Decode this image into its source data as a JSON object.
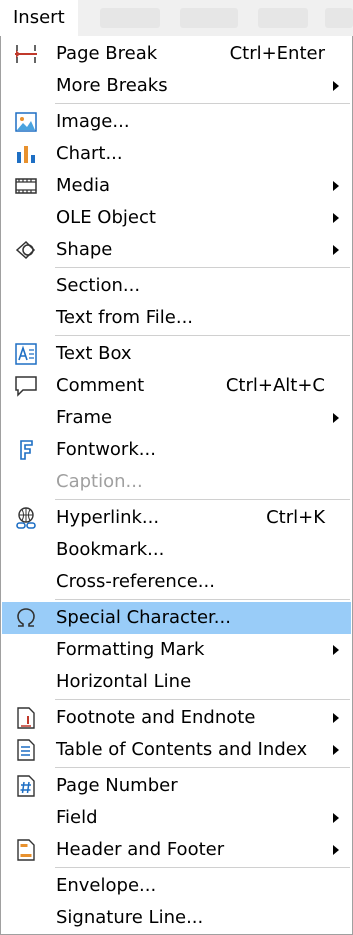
{
  "menubar": {
    "active_menu": "Insert"
  },
  "menu": {
    "items": [
      {
        "label": "Page Break",
        "shortcut": "Ctrl+Enter"
      },
      {
        "label": "More Breaks"
      },
      {
        "label": "Image..."
      },
      {
        "label": "Chart..."
      },
      {
        "label": "Media"
      },
      {
        "label": "OLE Object"
      },
      {
        "label": "Shape"
      },
      {
        "label": "Section..."
      },
      {
        "label": "Text from File..."
      },
      {
        "label": "Text Box"
      },
      {
        "label": "Comment",
        "shortcut": "Ctrl+Alt+C"
      },
      {
        "label": "Frame"
      },
      {
        "label": "Fontwork..."
      },
      {
        "label": "Caption...",
        "state": "disabled"
      },
      {
        "label": "Hyperlink...",
        "shortcut": "Ctrl+K"
      },
      {
        "label": "Bookmark..."
      },
      {
        "label": "Cross-reference..."
      },
      {
        "label": "Special Character...",
        "state": "highlighted"
      },
      {
        "label": "Formatting Mark"
      },
      {
        "label": "Horizontal Line"
      },
      {
        "label": "Footnote and Endnote"
      },
      {
        "label": "Table of Contents and Index"
      },
      {
        "label": "Page Number"
      },
      {
        "label": "Field"
      },
      {
        "label": "Header and Footer"
      },
      {
        "label": "Envelope..."
      },
      {
        "label": "Signature Line..."
      }
    ]
  },
  "colors": {
    "highlight": "#99ccf8",
    "disabled_text": "#a0a0a0",
    "icon_blue": "#1e6fc4",
    "icon_orange": "#e8912e"
  }
}
